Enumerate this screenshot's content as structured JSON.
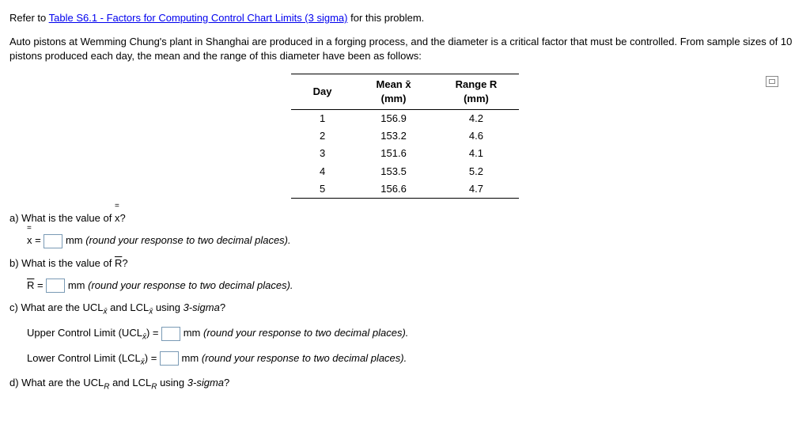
{
  "intro": {
    "prefix": "Refer to ",
    "link": "Table S6.1 - Factors for Computing Control Chart Limits (3 sigma)",
    "suffix": " for this problem."
  },
  "scenario": "Auto pistons at Wemming Chung's plant in Shanghai are produced in a forging process, and the diameter is a critical factor that must be controlled. From sample sizes of 10 pistons produced each day, the mean and the range of this diameter have been as follows:",
  "table": {
    "headers": {
      "day": "Day",
      "mean_top": "Mean x̄",
      "mean_unit": "(mm)",
      "range_top": "Range R",
      "range_unit": "(mm)"
    },
    "rows": [
      {
        "day": "1",
        "mean": "156.9",
        "range": "4.2"
      },
      {
        "day": "2",
        "mean": "153.2",
        "range": "4.6"
      },
      {
        "day": "3",
        "mean": "151.6",
        "range": "4.1"
      },
      {
        "day": "4",
        "mean": "153.5",
        "range": "5.2"
      },
      {
        "day": "5",
        "mean": "156.6",
        "range": "4.7"
      }
    ]
  },
  "qa": {
    "a_text": "a) What is the value of x̿?",
    "a_ans_prefix": "x̿ = ",
    "a_ans_suffix": " mm (round your response to two decimal places).",
    "b_text": "b) What is the value of R̄?",
    "b_ans_prefix": "R̄ = ",
    "b_ans_suffix": " mm (round your response to two decimal places).",
    "c_text": "c) What are the UCL",
    "c_text2": " and LCL",
    "c_text3": " using 3-sigma?",
    "c_ucl_prefix": "Upper Control Limit (UCL",
    "c_ucl_mid": ") = ",
    "c_ucl_suffix": " mm (round your response to two decimal places).",
    "c_lcl_prefix": "Lower Control Limit (LCL",
    "c_lcl_mid": ") = ",
    "c_lcl_suffix": " mm (round your response to two decimal places).",
    "d_text1": "d) What are the UCL",
    "d_text2": " and LCL",
    "d_text3": " using 3-sigma?",
    "sub_xbar": "x̄",
    "sub_r": "R"
  }
}
